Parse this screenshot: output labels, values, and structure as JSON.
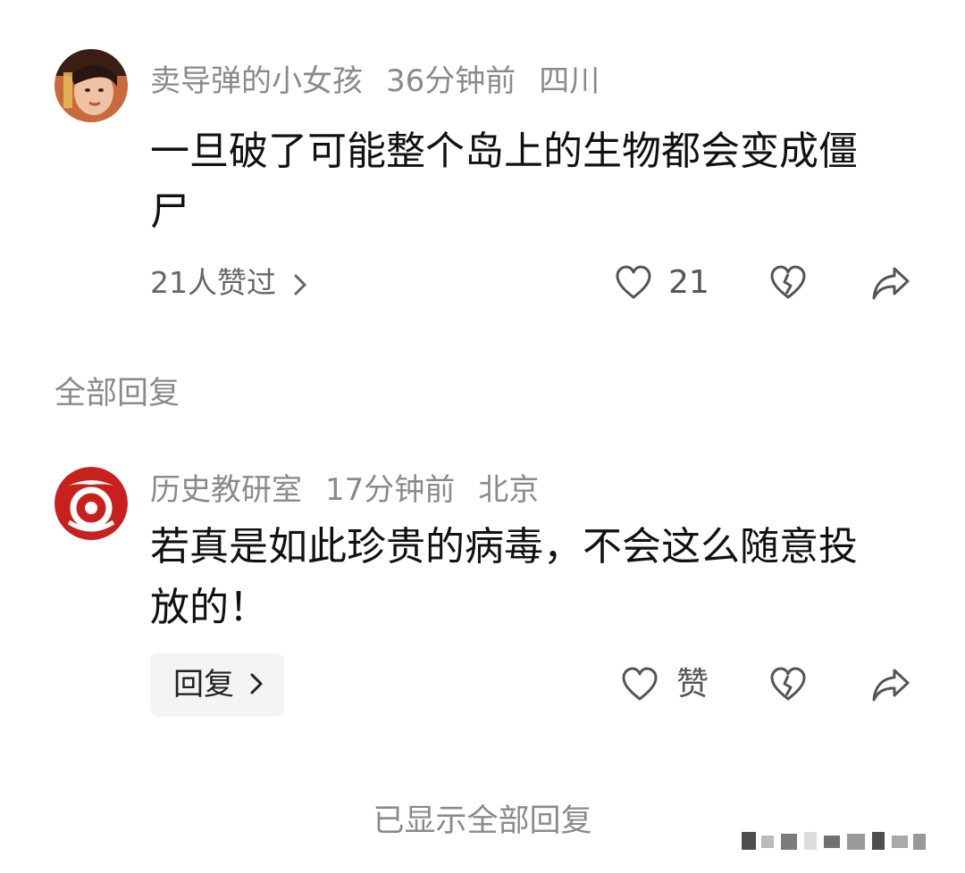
{
  "comment": {
    "author": "卖导弹的小女孩",
    "time": "36分钟前",
    "location": "四川",
    "text": "一旦破了可能整个岛上的生物都会变成僵尸",
    "likes_summary": "21人赞过",
    "like_count": "21"
  },
  "section_label": "全部回复",
  "reply": {
    "author": "历史教研室",
    "time": "17分钟前",
    "location": "北京",
    "text": "若真是如此珍贵的病毒，不会这么随意投放的！",
    "reply_button_label": "回复",
    "like_label": "赞"
  },
  "footer_text": "已显示全部回复",
  "colors": {
    "meta_gray": "#8a8a8a",
    "avatar_red": "#c8201c",
    "button_bg": "#f4f4f4"
  }
}
